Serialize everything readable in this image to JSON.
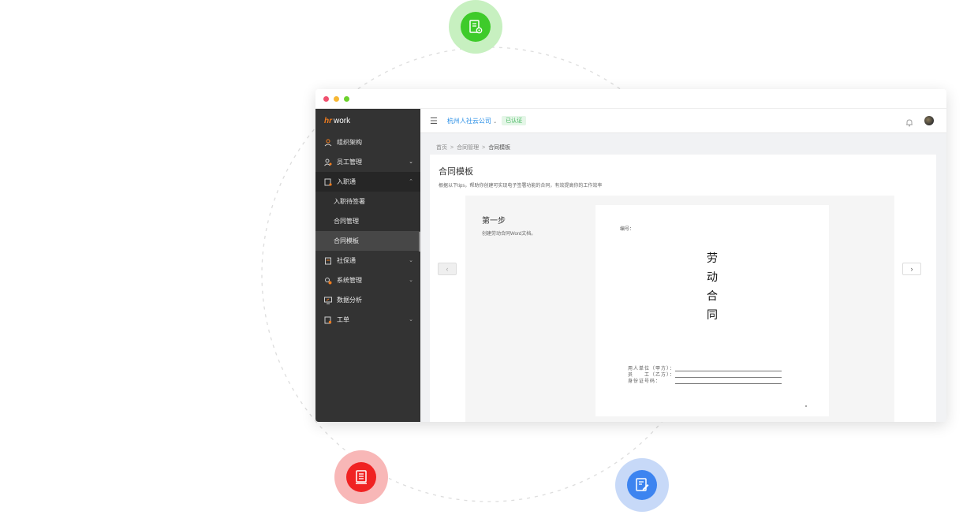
{
  "window": {
    "traffic_lights": [
      "#f0506e",
      "#f7b733",
      "#6cd12c"
    ]
  },
  "brand": {
    "logo_hr": "hr",
    "logo_work": "work",
    "accent": "#f07c1e"
  },
  "sidebar": {
    "items": [
      {
        "label": "组织架构",
        "icon": "org-chart-icon"
      },
      {
        "label": "员工管理",
        "icon": "employee-icon",
        "chevron": "⌄"
      },
      {
        "label": "入职通",
        "icon": "onboarding-icon",
        "chevron": "⌃"
      },
      {
        "label": "社保通",
        "icon": "social-insurance-icon",
        "chevron": "⌄"
      },
      {
        "label": "系统管理",
        "icon": "system-settings-icon",
        "chevron": "⌄"
      },
      {
        "label": "数据分析",
        "icon": "data-analysis-icon"
      },
      {
        "label": "工单",
        "icon": "work-order-icon",
        "chevron": "⌄"
      }
    ],
    "sub_items": [
      {
        "label": "入职待签署"
      },
      {
        "label": "合同管理"
      },
      {
        "label": "合同模板",
        "active": true
      }
    ]
  },
  "topbar": {
    "company": "杭州人社云公司",
    "verified": "已认证"
  },
  "breadcrumb": {
    "home": "首页",
    "parent": "合同管理",
    "current": "合同模板",
    "sep": ">"
  },
  "page": {
    "title": "合同模板",
    "description": "根据以下tips，帮助你创建可实现电子签署功能的合同，有效提高你的工作效率"
  },
  "step": {
    "title": "第一步",
    "description": "创建劳动合同Word文档。"
  },
  "document": {
    "number_label": "编号：",
    "title_chars": [
      "劳",
      "动",
      "合",
      "同"
    ],
    "fields": [
      {
        "label": "用人单位（甲方）："
      },
      {
        "label": "员　　工（乙方）："
      },
      {
        "label": "身份证号码："
      }
    ]
  },
  "carousel": {
    "prev": "‹",
    "next": "›"
  }
}
